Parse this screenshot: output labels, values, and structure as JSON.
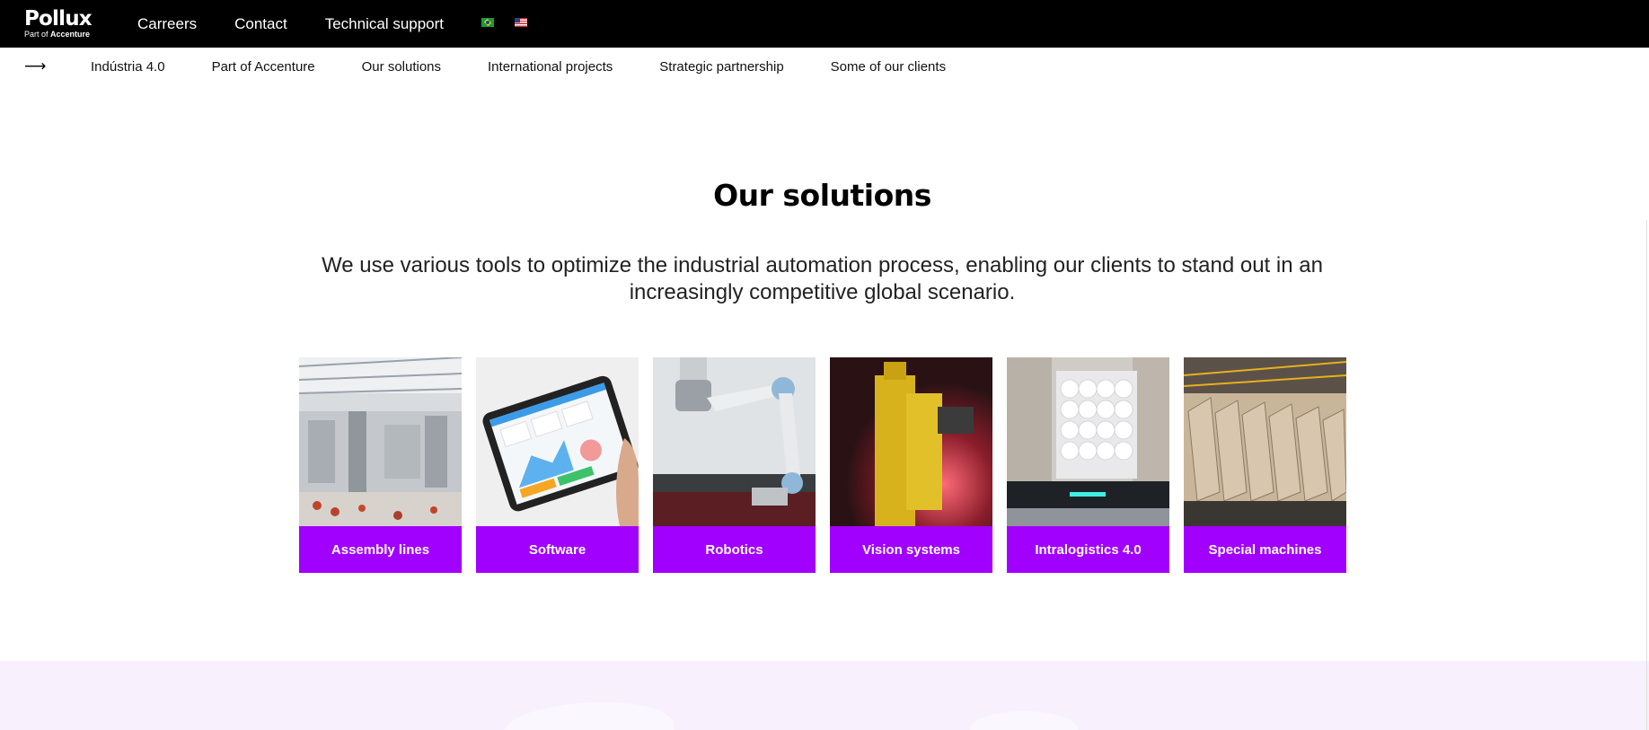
{
  "header": {
    "logo_name": "Pollux",
    "logo_sub_prefix": "Part of",
    "logo_sub_brand": "Accenture",
    "nav": [
      "Carreers",
      "Contact",
      "Technical support"
    ],
    "flags": [
      "brazil-flag-icon",
      "usa-flag-icon"
    ]
  },
  "subnav": {
    "arrow_icon": "arrow-right-icon",
    "items": [
      "Indústria 4.0",
      "Part of Accenture",
      "Our solutions",
      "International projects",
      "Strategic partnership",
      "Some of our clients"
    ]
  },
  "main": {
    "title": "Our solutions",
    "intro": "We use various tools to optimize the industrial automation process, enabling our clients to stand out in an increasingly competitive global scenario.",
    "cards": [
      {
        "label": "Assembly lines",
        "image": "factory-floor-photo"
      },
      {
        "label": "Software",
        "image": "tablet-dashboard-photo"
      },
      {
        "label": "Robotics",
        "image": "robot-arm-photo"
      },
      {
        "label": "Vision systems",
        "image": "camera-sensor-photo"
      },
      {
        "label": "Intralogistics 4.0",
        "image": "agv-warehouse-photo"
      },
      {
        "label": "Special machines",
        "image": "production-line-photo"
      }
    ]
  },
  "colors": {
    "topbar": "#000000",
    "accent": "#a100ff",
    "band": "#f8f0fd"
  }
}
